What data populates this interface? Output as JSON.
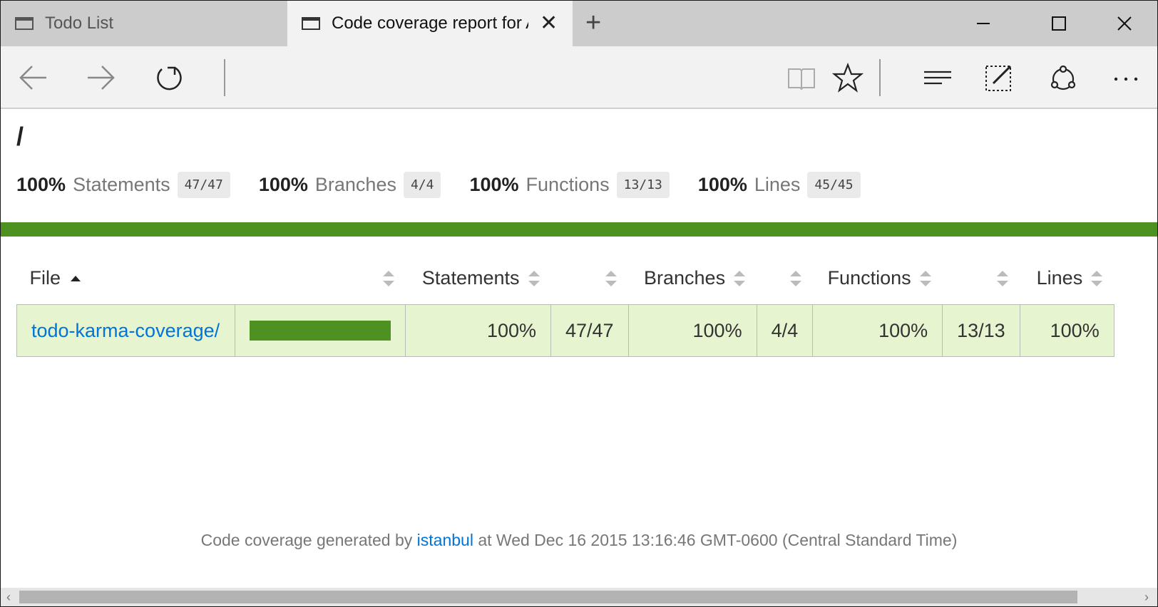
{
  "tabs": [
    {
      "title": "Todo List",
      "active": false
    },
    {
      "title": "Code coverage report for All files",
      "active": true
    }
  ],
  "report": {
    "path": "/",
    "summary": [
      {
        "pct": "100%",
        "label": "Statements",
        "fraction": "47/47"
      },
      {
        "pct": "100%",
        "label": "Branches",
        "fraction": "4/4"
      },
      {
        "pct": "100%",
        "label": "Functions",
        "fraction": "13/13"
      },
      {
        "pct": "100%",
        "label": "Lines",
        "fraction": "45/45"
      }
    ],
    "status_color": "#4d9221",
    "table": {
      "headers": {
        "file": "File",
        "statements": "Statements",
        "branches": "Branches",
        "functions": "Functions",
        "lines": "Lines"
      },
      "rows": [
        {
          "file": "todo-karma-coverage/",
          "coverage_fraction": 1.0,
          "statements_pct": "100%",
          "statements_frac": "47/47",
          "branches_pct": "100%",
          "branches_frac": "4/4",
          "functions_pct": "100%",
          "functions_frac": "13/13",
          "lines_pct": "100%"
        }
      ]
    },
    "footer": {
      "prefix": "Code coverage generated by",
      "link": "istanbul",
      "suffix": "at Wed Dec 16 2015 13:16:46 GMT-0600 (Central Standard Time)"
    }
  },
  "icons": [
    "tab-page-icon",
    "close-tab-icon",
    "new-tab-icon",
    "minimize-icon",
    "maximize-icon",
    "close-window-icon",
    "back-icon",
    "forward-icon",
    "refresh-icon",
    "reading-view-icon",
    "favorite-star-icon",
    "hub-icon",
    "web-note-icon",
    "share-icon",
    "more-icon"
  ]
}
